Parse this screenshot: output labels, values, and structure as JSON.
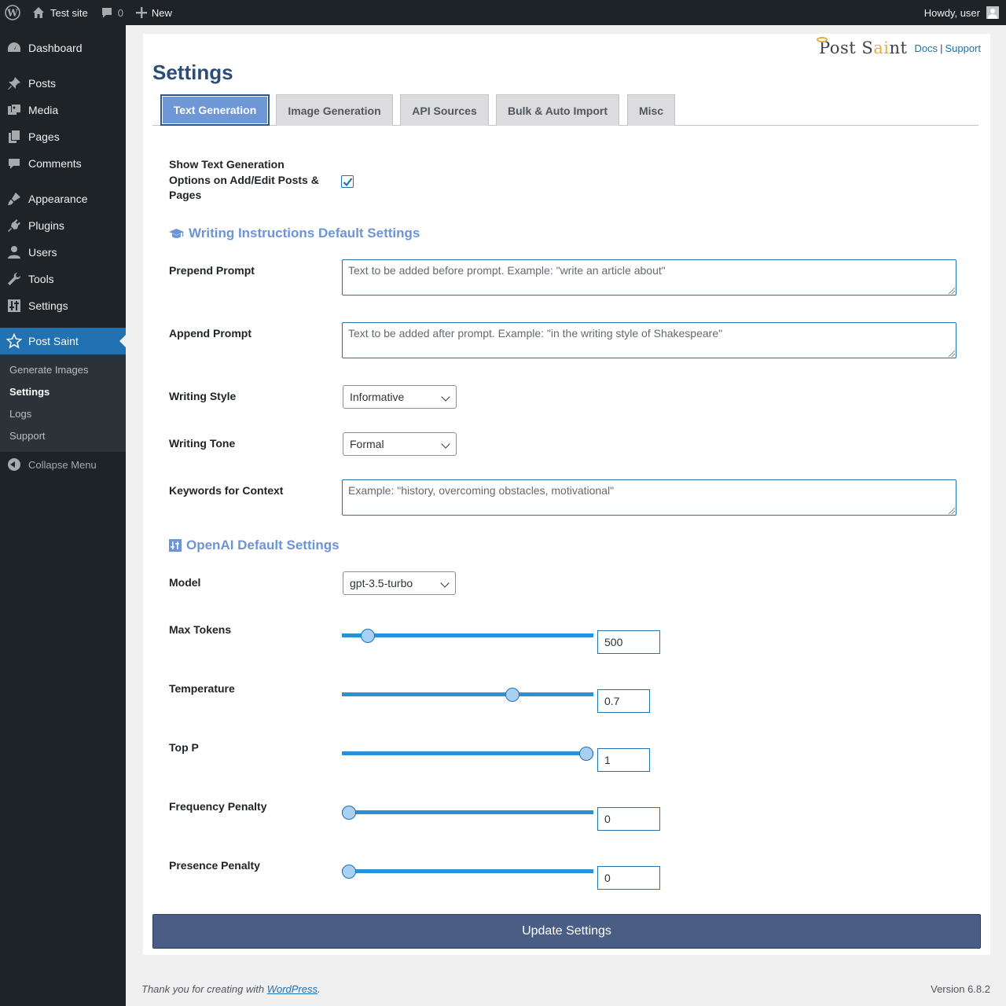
{
  "adminbar": {
    "site_name": "Test site",
    "comments_count": "0",
    "new_label": "New",
    "howdy": "Howdy, user"
  },
  "sidebar": {
    "items": [
      {
        "label": "Dashboard",
        "icon": "dashboard-icon"
      },
      {
        "label": "Posts",
        "icon": "pin-icon"
      },
      {
        "label": "Media",
        "icon": "media-icon"
      },
      {
        "label": "Pages",
        "icon": "pages-icon"
      },
      {
        "label": "Comments",
        "icon": "comments-icon"
      },
      {
        "label": "Appearance",
        "icon": "brush-icon"
      },
      {
        "label": "Plugins",
        "icon": "plugin-icon"
      },
      {
        "label": "Users",
        "icon": "user-icon"
      },
      {
        "label": "Tools",
        "icon": "wrench-icon"
      },
      {
        "label": "Settings",
        "icon": "sliders-icon"
      },
      {
        "label": "Post Saint",
        "icon": "star-icon"
      }
    ],
    "submenu": [
      "Generate Images",
      "Settings",
      "Logs",
      "Support"
    ],
    "collapse_label": "Collapse Menu"
  },
  "brand": {
    "logo_part1": "Post S",
    "logo_gold": "ai",
    "logo_part2": "nt",
    "docs": "Docs",
    "separator": "|",
    "support": "Support"
  },
  "page_title": "Settings",
  "tabs": [
    {
      "label": "Text Generation",
      "active": true
    },
    {
      "label": "Image Generation",
      "active": false
    },
    {
      "label": "API Sources",
      "active": false
    },
    {
      "label": "Bulk & Auto Import",
      "active": false
    },
    {
      "label": "Misc",
      "active": false
    }
  ],
  "form": {
    "show_options_label": "Show Text Generation Options on Add/Edit Posts & Pages",
    "show_options_checked": true,
    "writing_section": "Writing Instructions Default Settings",
    "prepend_label": "Prepend Prompt",
    "prepend_placeholder": "Text to be added before prompt. Example: \"write an article about\"",
    "append_label": "Append Prompt",
    "append_placeholder": "Text to be added after prompt. Example: \"in the writing style of Shakespeare\"",
    "style_label": "Writing Style",
    "style_value": "Informative",
    "tone_label": "Writing Tone",
    "tone_value": "Formal",
    "keywords_label": "Keywords for Context",
    "keywords_placeholder": "Example: \"history, overcoming obstacles, motivational\"",
    "openai_section": "OpenAI Default Settings",
    "model_label": "Model",
    "model_value": "gpt-3.5-turbo",
    "sliders": [
      {
        "label": "Max Tokens",
        "value": "500",
        "fraction": 0.08
      },
      {
        "label": "Temperature",
        "value": "0.7",
        "fraction": 0.69
      },
      {
        "label": "Top P",
        "value": "1",
        "fraction": 1.0
      },
      {
        "label": "Frequency Penalty",
        "value": "0",
        "fraction": 0.0
      },
      {
        "label": "Presence Penalty",
        "value": "0",
        "fraction": 0.0
      }
    ],
    "update_button": "Update Settings"
  },
  "footer": {
    "thanks_prefix": "Thank you for creating with ",
    "thanks_link": "WordPress",
    "thanks_suffix": ".",
    "version": "Version 6.8.2"
  },
  "colors": {
    "accent": "#2271b1",
    "tab_active": "#6e97d8",
    "section_heading": "#6d94d6",
    "update_button": "#4a5e85"
  }
}
